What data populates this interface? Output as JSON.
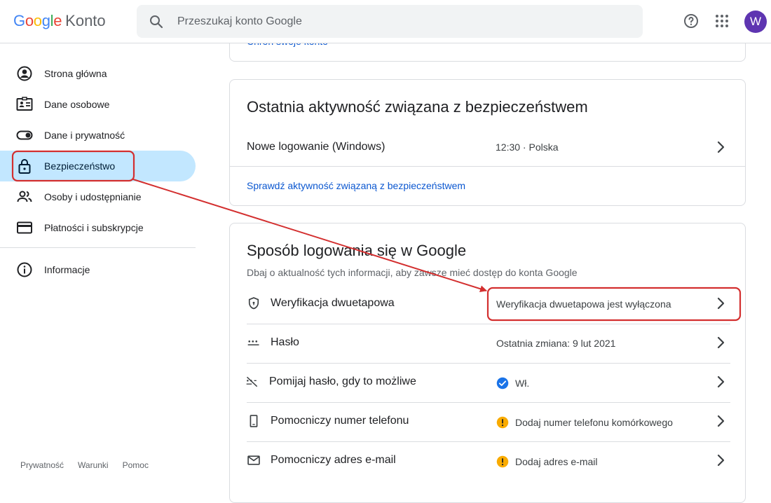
{
  "header": {
    "logo_letters": [
      "G",
      "o",
      "o",
      "g",
      "l",
      "e"
    ],
    "logo_colors": [
      "#4285F4",
      "#EA4335",
      "#FBBC05",
      "#4285F4",
      "#34A853",
      "#EA4335"
    ],
    "product": "Konto",
    "search_placeholder": "Przeszukaj konto Google",
    "avatar_letter": "W",
    "icons": [
      "search-icon",
      "help-icon",
      "apps-grid-icon"
    ]
  },
  "sidebar": {
    "items": [
      {
        "label": "Strona główna",
        "icon": "account-circle-icon"
      },
      {
        "label": "Dane osobowe",
        "icon": "id-card-icon"
      },
      {
        "label": "Dane i prywatność",
        "icon": "toggle-icon"
      },
      {
        "label": "Bezpieczeństwo",
        "icon": "lock-icon",
        "active": true
      },
      {
        "label": "Osoby i udostępnianie",
        "icon": "people-icon"
      },
      {
        "label": "Płatności i subskrypcje",
        "icon": "credit-card-icon"
      }
    ],
    "info": {
      "label": "Informacje",
      "icon": "info-icon"
    },
    "footer": [
      "Prywatność",
      "Warunki",
      "Pomoc"
    ]
  },
  "main": {
    "top_card_link": "Chroń swoje konto",
    "activity": {
      "title": "Ostatnia aktywność związana z bezpieczeństwem",
      "row_label": "Nowe logowanie (Windows)",
      "row_value": "12:30 · Polska",
      "link": "Sprawdź aktywność związaną z bezpieczeństwem"
    },
    "signin": {
      "title": "Sposób logowania się w Google",
      "subtitle": "Dbaj o aktualność tych informacji, aby zawsze mieć dostęp do konta Google",
      "rows": [
        {
          "label": "Weryfikacja dwuetapowa",
          "value": "Weryfikacja dwuetapowa jest wyłączona",
          "icon": "shield-icon",
          "status": ""
        },
        {
          "label": "Hasło",
          "value": "Ostatnia zmiana: 9 lut 2021",
          "icon": "password-dots-icon",
          "status": ""
        },
        {
          "label": "Pomijaj hasło, gdy to możliwe",
          "value": "Wł.",
          "icon": "password-off-icon",
          "status": "check"
        },
        {
          "label": "Pomocniczy numer telefonu",
          "value": "Dodaj numer telefonu komórkowego",
          "icon": "phone-icon",
          "status": "warning"
        },
        {
          "label": "Pomocniczy adres e-mail",
          "value": "Dodaj adres e-mail",
          "icon": "mail-icon",
          "status": "warning"
        }
      ]
    }
  },
  "colors": {
    "accent": "#0b57d0",
    "active_nav": "#c2e7ff",
    "annotation_red": "#d32f2f",
    "check_blue": "#1a73e8",
    "warning_yellow": "#f9ab00"
  }
}
